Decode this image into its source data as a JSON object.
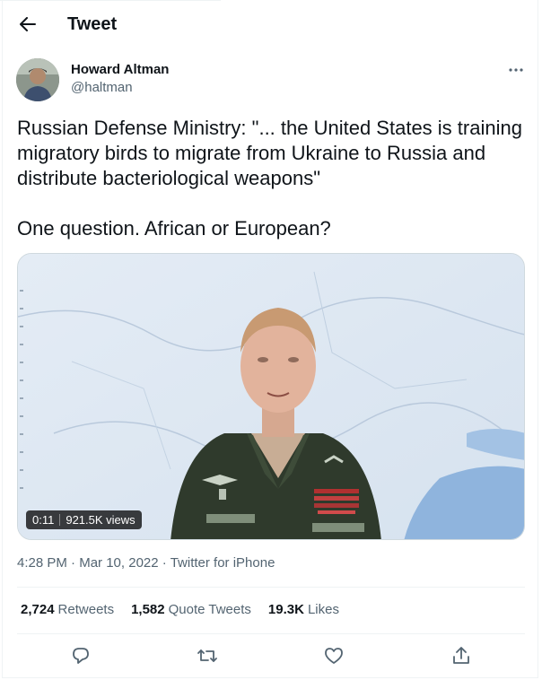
{
  "header": {
    "title": "Tweet",
    "back_icon": "arrow-left-icon"
  },
  "author": {
    "name": "Howard Altman",
    "handle": "@haltman",
    "more_icon": "more-horizontal-icon"
  },
  "tweet": {
    "text_line1": "Russian Defense Ministry: \"... the United States is training migratory birds to migrate from Ukraine to Russia and distribute bacteriological weapons\"",
    "text_line2": "One question. African or European?"
  },
  "media": {
    "duration": "0:11",
    "views": "921.5K views"
  },
  "meta": {
    "time": "4:28 PM",
    "date": "Mar 10, 2022",
    "source": "Twitter for iPhone",
    "separator": "·"
  },
  "stats": [
    {
      "count": "2,724",
      "label": "Retweets"
    },
    {
      "count": "1,582",
      "label": "Quote Tweets"
    },
    {
      "count": "19.3K",
      "label": "Likes"
    }
  ],
  "actions": [
    "reply-icon",
    "retweet-icon",
    "like-icon",
    "share-icon"
  ],
  "colors": {
    "text": "#0f1419",
    "secondary": "#536471",
    "border": "#eff3f4"
  }
}
